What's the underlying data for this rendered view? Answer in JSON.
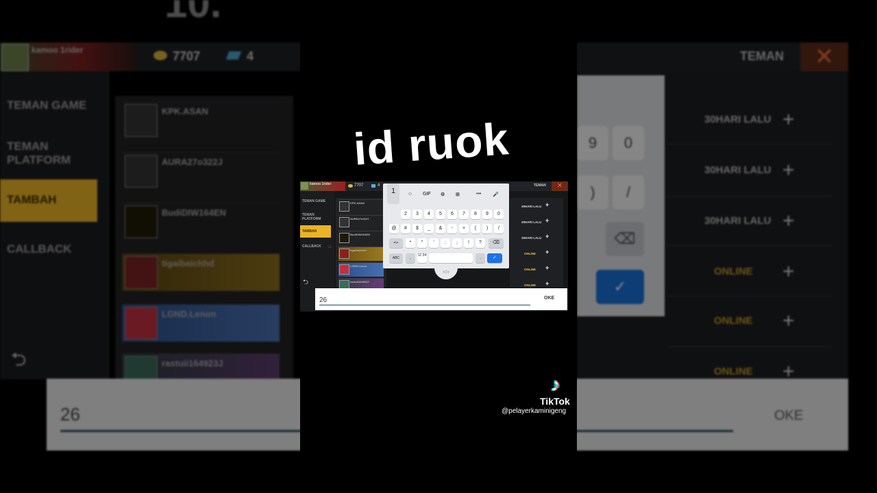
{
  "caption": "id ruok",
  "game": {
    "player_name": "kamoo 1rider",
    "coins": "7707",
    "gems": "4",
    "panel_title": "TEMAN",
    "close_label": "✕",
    "sidebar": {
      "items": [
        "TEMAN GAME",
        "TEMAN PLATFORM",
        "TAMBAH",
        "CALLBACK"
      ],
      "active": "TAMBAH"
    },
    "friends": [
      {
        "name": "KPK.ASAN",
        "status": "30HARI LALU"
      },
      {
        "name": "AURA27o322J",
        "status": "30HARI LALU"
      },
      {
        "name": "BudiDIW164EN",
        "status": "30HARI LALU"
      },
      {
        "name": "tigaibaichhd",
        "status": "ONLINE"
      },
      {
        "name": "LGND.Lenon",
        "status": "ONLINE"
      },
      {
        "name": "rastuii164923J",
        "status": "ONLINE"
      }
    ],
    "add_label": "+",
    "back_label": "⮌"
  },
  "keyboard": {
    "toolbar": [
      "☺",
      "GIF",
      "⚙",
      "⊞",
      "•••",
      "🎤"
    ],
    "popup_key": "1",
    "row1": [
      "2",
      "3",
      "4",
      "5",
      "6",
      "7",
      "8",
      "9",
      "0"
    ],
    "row2": [
      "@",
      "#",
      "$",
      "_",
      "&",
      "-",
      "+",
      "(",
      ")",
      "/"
    ],
    "row3": [
      "=\\<",
      "*",
      "\"",
      "'",
      ":",
      ";",
      "!",
      "?",
      "⌫"
    ],
    "row4": [
      "ABC",
      ",",
      "12 34",
      "",
      ".",
      "✓"
    ],
    "handle": "‹◇›"
  },
  "input": {
    "value": "26",
    "ok_label": "OKE"
  },
  "watermark": {
    "brand": "TikTok",
    "user": "@pelayerkaminigeng"
  }
}
